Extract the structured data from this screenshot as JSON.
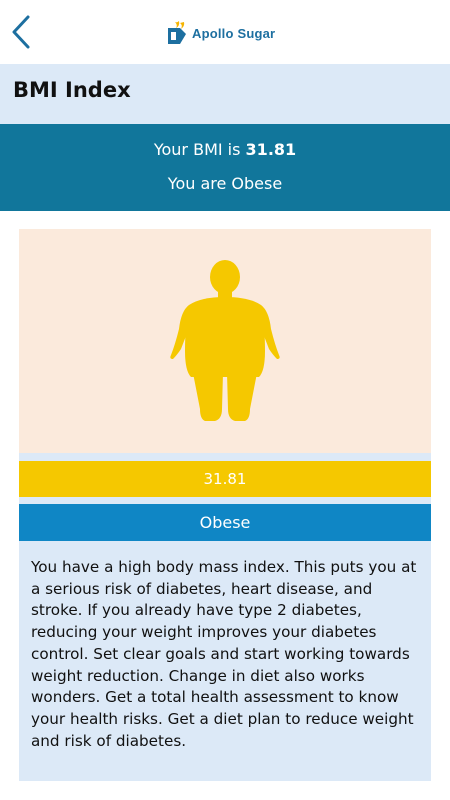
{
  "app": {
    "brand_name": "Apollo Sugar"
  },
  "header": {
    "title": "BMI Index"
  },
  "result": {
    "bmi_prefix": "Your BMI is ",
    "bmi_value": "31.81",
    "category_sentence": "You are Obese"
  },
  "card": {
    "bmi_bar_value": "31.81",
    "category_label": "Obese",
    "advice": "You have a high body mass index. This puts you at a serious risk of diabetes, heart disease, and stroke. If you already have type 2 diabetes, reducing your weight improves your diabetes control. Set clear goals and start working towards weight reduction. Change in diet also works wonders. Get a total health assessment to know your health risks. Get a diet plan to reduce weight and risk of diabetes."
  },
  "icons": {
    "back": "chevron-left-icon",
    "logo": "apollo-sugar-logo",
    "figure": "obese-body-figure"
  },
  "colors": {
    "brand_blue": "#1d6fa0",
    "header_bg": "#dce9f7",
    "result_band": "#11769b",
    "figure_bg": "#fbeadc",
    "figure_fill": "#f5c800",
    "value_bar": "#f5c800",
    "category_bar": "#0f86c5"
  }
}
